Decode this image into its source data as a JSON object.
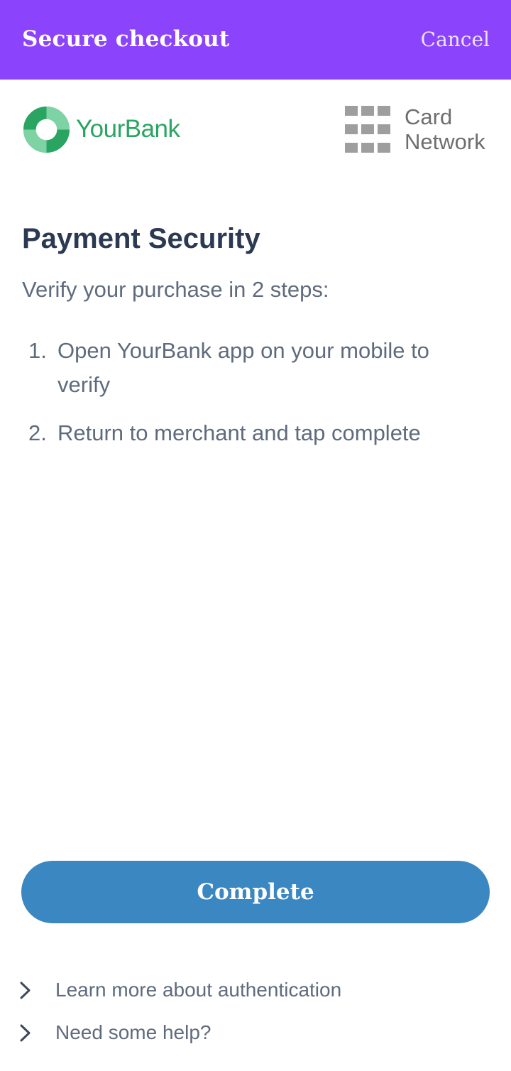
{
  "header": {
    "title": "Secure checkout",
    "cancel_label": "Cancel",
    "background_color": "#8c43fc"
  },
  "logos": {
    "bank_name": "YourBank",
    "bank_color": "#2aa561",
    "network_line1": "Card",
    "network_line2": "Network"
  },
  "main": {
    "title": "Payment Security",
    "intro": "Verify your purchase in 2 steps:",
    "steps": [
      {
        "number": "1.",
        "text": "Open YourBank app on your mobile to verify"
      },
      {
        "number": "2.",
        "text": "Return to merchant and tap complete"
      }
    ]
  },
  "actions": {
    "complete_label": "Complete",
    "button_color": "#3b87c1"
  },
  "help_links": [
    {
      "label": "Learn more about authentication",
      "icon": "chevron-right-icon"
    },
    {
      "label": "Need some help?",
      "icon": "chevron-right-icon"
    }
  ]
}
